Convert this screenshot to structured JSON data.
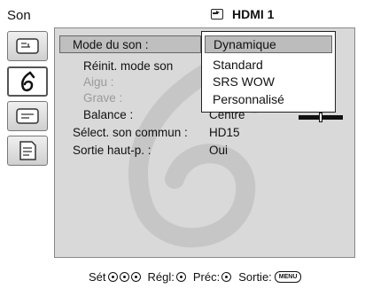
{
  "header": {
    "menu_title": "Son",
    "input_icon": "input-arrow-icon",
    "input_name": "HDMI 1"
  },
  "tabs": [
    {
      "icon": "picture-icon"
    },
    {
      "icon": "sound-icon",
      "active": true
    },
    {
      "icon": "screen-icon"
    },
    {
      "icon": "settings-icon"
    }
  ],
  "settings": [
    {
      "label": "Mode du son :",
      "value": ""
    },
    {
      "label": "Réinit. mode son",
      "value": ""
    },
    {
      "label": "Aigu :",
      "value": "",
      "disabled": true
    },
    {
      "label": "Grave :",
      "value": "",
      "disabled": true
    },
    {
      "label": "Balance :",
      "value": "Centre"
    },
    {
      "label": "Sélect. son commun :",
      "value": "HD15"
    },
    {
      "label": "Sortie haut-p. :",
      "value": "Oui"
    }
  ],
  "dropdown": {
    "options": [
      "Dynamique",
      "Standard",
      "SRS WOW",
      "Personnalisé"
    ],
    "selected": "Dynamique"
  },
  "balance_level": 0.5,
  "footer": {
    "select": "Sét",
    "adjust": "Régl:",
    "back": "Préc:",
    "exit": "Sortie:",
    "menu_button": "MENU"
  }
}
